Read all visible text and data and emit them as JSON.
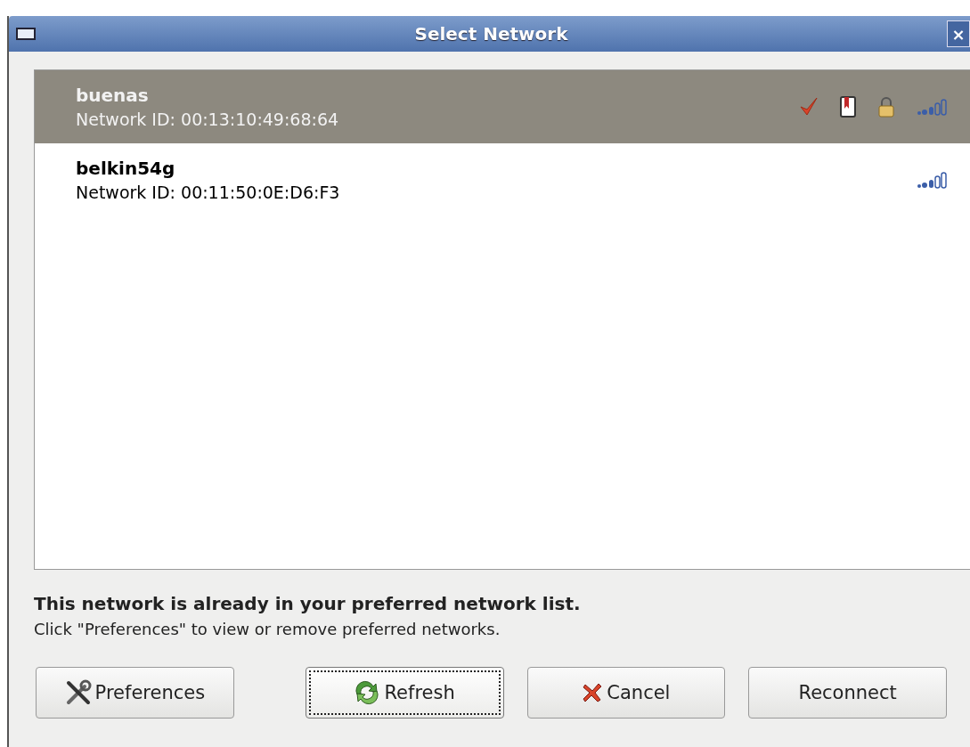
{
  "window": {
    "title": "Select Network",
    "close": "×"
  },
  "networks": [
    {
      "name": "buenas",
      "network_id": "Network ID: 00:13:10:49:68:64",
      "selected": true,
      "connected": true,
      "preferred": true,
      "encrypted": true
    },
    {
      "name": "belkin54g",
      "network_id": "Network ID: 00:11:50:0E:D6:F3",
      "selected": false,
      "connected": false,
      "preferred": false,
      "encrypted": false
    }
  ],
  "message": {
    "heading": "This network is already in your preferred network list.",
    "detail": "Click \"Preferences\" to view or remove preferred networks."
  },
  "buttons": [
    {
      "kind": "preferences",
      "label": "Preferences",
      "focused": false
    },
    {
      "kind": "refresh",
      "label": "Refresh",
      "focused": true
    },
    {
      "kind": "cancel",
      "label": "Cancel",
      "focused": false
    },
    {
      "kind": "plain",
      "label": "Reconnect",
      "focused": false
    }
  ]
}
